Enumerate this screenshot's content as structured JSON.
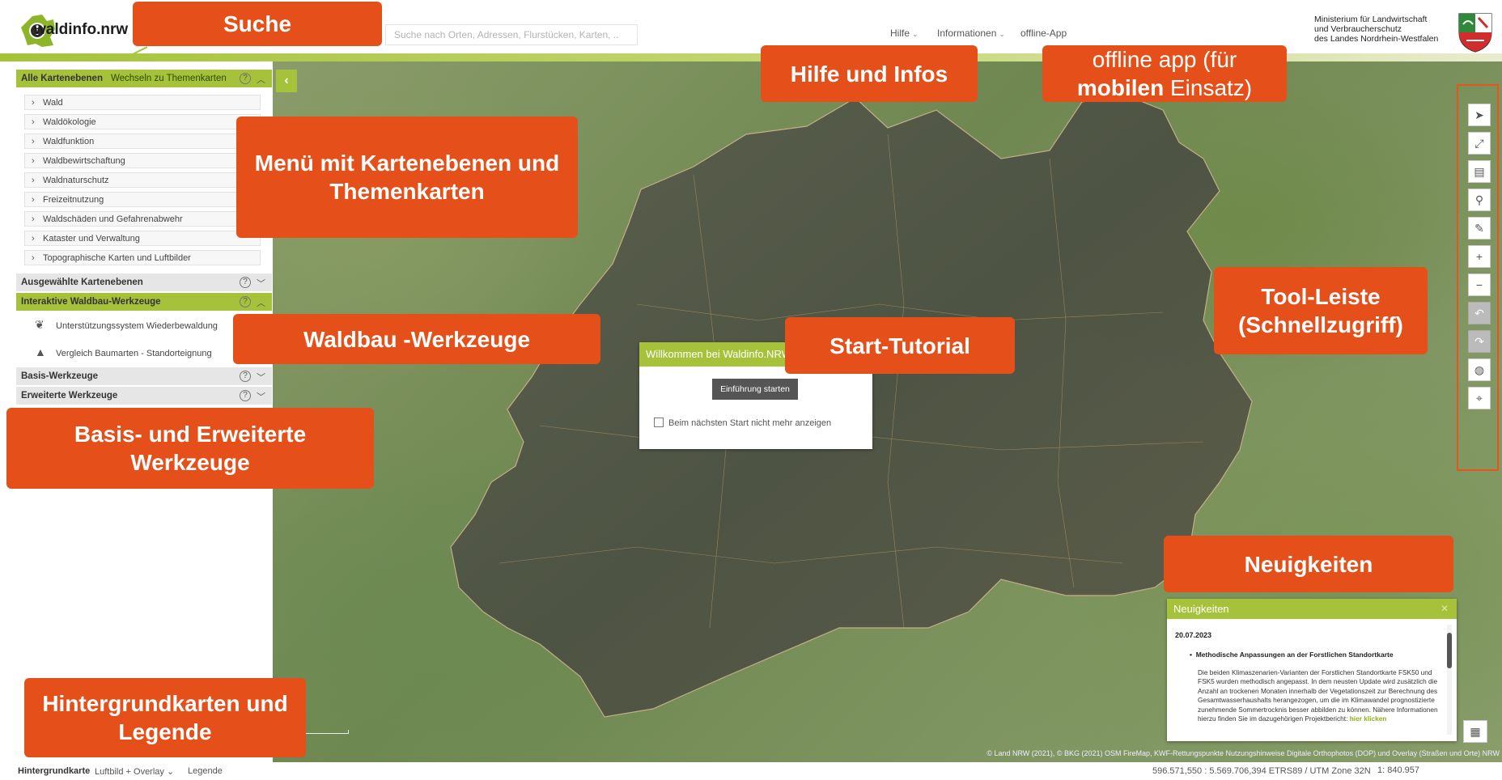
{
  "header": {
    "logo_text": "waldinfo",
    "logo_tld": ".nrw",
    "search_placeholder": "Suche nach Orten, Adressen, Flurstücken, Karten, ..",
    "nav": [
      {
        "label": "Hilfe"
      },
      {
        "label": "Informationen"
      },
      {
        "label": "offline-App"
      }
    ],
    "ministry_line1": "Ministerium für Landwirtschaft",
    "ministry_line2": "und Verbraucherschutz",
    "ministry_line3": "des Landes Nordrhein-Westfalen"
  },
  "sidebar": {
    "all_layers_title": "Alle Kartenebenen",
    "switch_link": "Wechseln zu Themenkarten",
    "layers": [
      "Wald",
      "Waldökologie",
      "Waldfunktion",
      "Waldbewirtschaftung",
      "Waldnaturschutz",
      "Freizeitnutzung",
      "Waldschäden und Gefahrenabwehr",
      "Kataster und Verwaltung",
      "Topographische Karten und Luftbilder"
    ],
    "selected_layers_title": "Ausgewählte Kartenebenen",
    "waldbau_title": "Interaktive Waldbau-Werkzeuge",
    "waldbau_tools": [
      "Unterstützungssystem Wiederbewaldung",
      "Vergleich Baumarten - Standorteignung"
    ],
    "basis_title": "Basis-Werkzeuge",
    "extended_title": "Erweiterte Werkzeuge",
    "help_symbol": "?"
  },
  "dialog": {
    "title": "Willkommen bei Waldinfo.NRW",
    "start_button": "Einführung starten",
    "checkbox_label": "Beim nächsten Start nicht mehr anzeigen"
  },
  "news": {
    "title": "Neuigkeiten",
    "date": "20.07.2023",
    "headline": "Methodische Anpassungen an der Forstlichen Standortkarte",
    "body": "Die beiden Klimaszenarien-Varianten der Forstlichen Standortkarte FSK50 und FSK5 wurden methodisch angepasst. In dem neusten Update wird zusätzlich die Anzahl an trockenen Monaten innerhalb der Vegetationszeit zur Berechnung des Gesamtwasserhaushalts herangezogen, um die im Klimawandel prognostizierte zunehmende Sommertrocknis besser abbilden zu können. Nähere Informationen hierzu finden Sie im dazugehörigen Projektbericht:",
    "link": "hier klicken"
  },
  "bottom": {
    "background_label": "Hintergrundkarte",
    "background_value": "Luftbild + Overlay",
    "legend": "Legende",
    "coordinates": "596.571,550 : 5.569.706,394  ETRS89 / UTM Zone 32N",
    "scale": "1: 840.957"
  },
  "map": {
    "attribution": "© Land NRW (2021), © BKG (2021) OSM FireMap, KWF-Rettungspunkte Nutzungshinweise    Digitale Orthophotos (DOP) und Overlay (Straßen und Orte) NRW"
  },
  "callouts": {
    "search": "Suche",
    "help_info": "Hilfe und Infos",
    "offline_line1": "offline app (für",
    "offline_bold": "mobilen",
    "offline_line2": " Einsatz)",
    "menu": "Menü mit Kartenebenen und Themenkarten",
    "waldbau": "Waldbau -Werkzeuge",
    "tutorial": "Start-Tutorial",
    "toolbar": "Tool-Leiste (Schnellzugriff)",
    "basis": "Basis- und Erweiterte Werkzeuge",
    "news": "Neuigkeiten",
    "background": "Hintergrundkarten und Legende"
  },
  "toolbar_icons": [
    "north-arrow",
    "fullscreen",
    "print",
    "marker",
    "measure",
    "zoom-in",
    "zoom-out",
    "undo",
    "redo",
    "globe",
    "locate"
  ],
  "colors": {
    "accent_green": "#a6c23a",
    "callout_orange": "#e5501a"
  }
}
